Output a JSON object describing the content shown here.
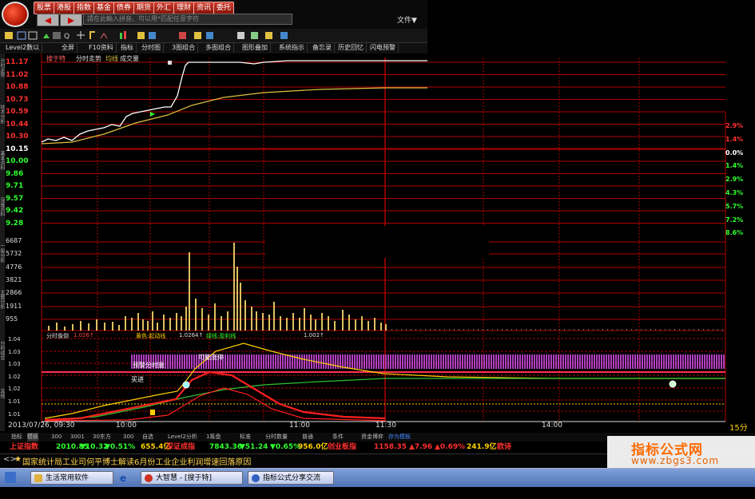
{
  "top_buttons": [
    "股票",
    "港股",
    "指数",
    "基金",
    "债券",
    "期货",
    "外汇",
    "理财",
    "资讯",
    "委托"
  ],
  "search_placeholder": "請在此輸入拼音、可以用*匹配任意字符",
  "file_menu": "文件▼",
  "tabs": [
    "Level2數以",
    "全屏",
    "F10资料",
    "指标",
    "分时图",
    "3图组合",
    "多图组合",
    "图形叠加",
    "系统指示",
    "备忘录",
    "历史回忆",
    "闪电预警"
  ],
  "side_labels": [
    "分时走势",
    "技术分析",
    "基本资料",
    "深度资料",
    "一般分析",
    "主题分析",
    "分时成交",
    "其他"
  ],
  "stock_title": "搜于特",
  "chart_legend": [
    "分时走势",
    "均线",
    "成交量"
  ],
  "price_ticks": [
    "11.17",
    "11.02",
    "10.88",
    "10.73",
    "10.59",
    "10.44",
    "10.30",
    "10.15",
    "10.00",
    "9.86",
    "9.71",
    "9.57",
    "9.42",
    "9.28"
  ],
  "price_colors": [
    "#ff3030",
    "#ff3030",
    "#ff3030",
    "#ff3030",
    "#ff3030",
    "#ff3030",
    "#ff3030",
    "#ffffff",
    "#30ff30",
    "#30ff30",
    "#30ff30",
    "#30ff30",
    "#30ff30",
    "#30ff30"
  ],
  "pct_ticks": [
    "2.9%",
    "1.4%",
    "0.0%",
    "1.4%",
    "2.9%",
    "4.3%",
    "5.7%",
    "7.2%",
    "8.6%"
  ],
  "pct_colors": [
    "#ff3030",
    "#ff3030",
    "#ffffff",
    "#30ff30",
    "#30ff30",
    "#30ff30",
    "#30ff30",
    "#30ff30",
    "#30ff30"
  ],
  "volume_ticks": [
    "6687",
    "5732",
    "4776",
    "3821",
    "2866",
    "1911",
    "955"
  ],
  "indicator_header": "分时像倒",
  "indicator_header_values": [
    "1.026↑",
    "黄色:起动线",
    "1.0264↑",
    "绿线:盈利线",
    "1.002↑"
  ],
  "indicator_ticks": [
    "1.04",
    "1.03",
    "1.03",
    "1.02",
    "1.02",
    "1.01",
    "1.01"
  ],
  "indicator_labels": [
    "预警分时量",
    "可能涨停",
    "买进"
  ],
  "time_labels": [
    "2013/07/26, 09:30",
    "10:00",
    "11:00",
    "11:30",
    "14:00"
  ],
  "period_label": "15分时",
  "sub_tabs": [
    "指标",
    "模板",
    "300",
    "3001",
    "30东方",
    "300",
    "自选",
    "Level2分析",
    "1筹盘",
    "标准",
    "分时数量",
    "普通",
    "条件",
    "资金博弈",
    "存为模板"
  ],
  "index_bar": [
    {
      "text": "上证指数",
      "color": "#ff3030"
    },
    {
      "text": "2010.85",
      "color": "#30ff30"
    },
    {
      "text": "▼10.32",
      "color": "#30ff30"
    },
    {
      "text": "▼0.51%",
      "color": "#30ff30"
    },
    {
      "text": "655.4亿",
      "color": "#ffd000"
    },
    {
      "text": "深证成指",
      "color": "#ff3030"
    },
    {
      "text": "7843.36",
      "color": "#30ff30"
    },
    {
      "text": "▼51.24",
      "color": "#30ff30"
    },
    {
      "text": "▼0.65%",
      "color": "#30ff30"
    },
    {
      "text": "956.0亿",
      "color": "#ffd000"
    },
    {
      "text": "创业板指",
      "color": "#ff3030"
    },
    {
      "text": "1158.35",
      "color": "#ff3030"
    },
    {
      "text": "▲7.96",
      "color": "#ff3030"
    },
    {
      "text": "▲0.69%",
      "color": "#ff3030"
    },
    {
      "text": "241.9亿",
      "color": "#ffd000"
    },
    {
      "text": "欧诗",
      "color": "#ff3030"
    }
  ],
  "news_text": "国家统计局工业司何平博士解读6月份工业企业利润增速回落原因",
  "taskbar": [
    "生活常用软件",
    "大智慧 - [搜于特]",
    "指标公式分享交流区..."
  ],
  "watermark_title": "指标公式网",
  "watermark_url": "www.zbgs3.com",
  "colors": {
    "grid": "#b00000",
    "price_line": "#ffffff",
    "avg_line": "#e0c040",
    "volume": "#e0c060"
  }
}
